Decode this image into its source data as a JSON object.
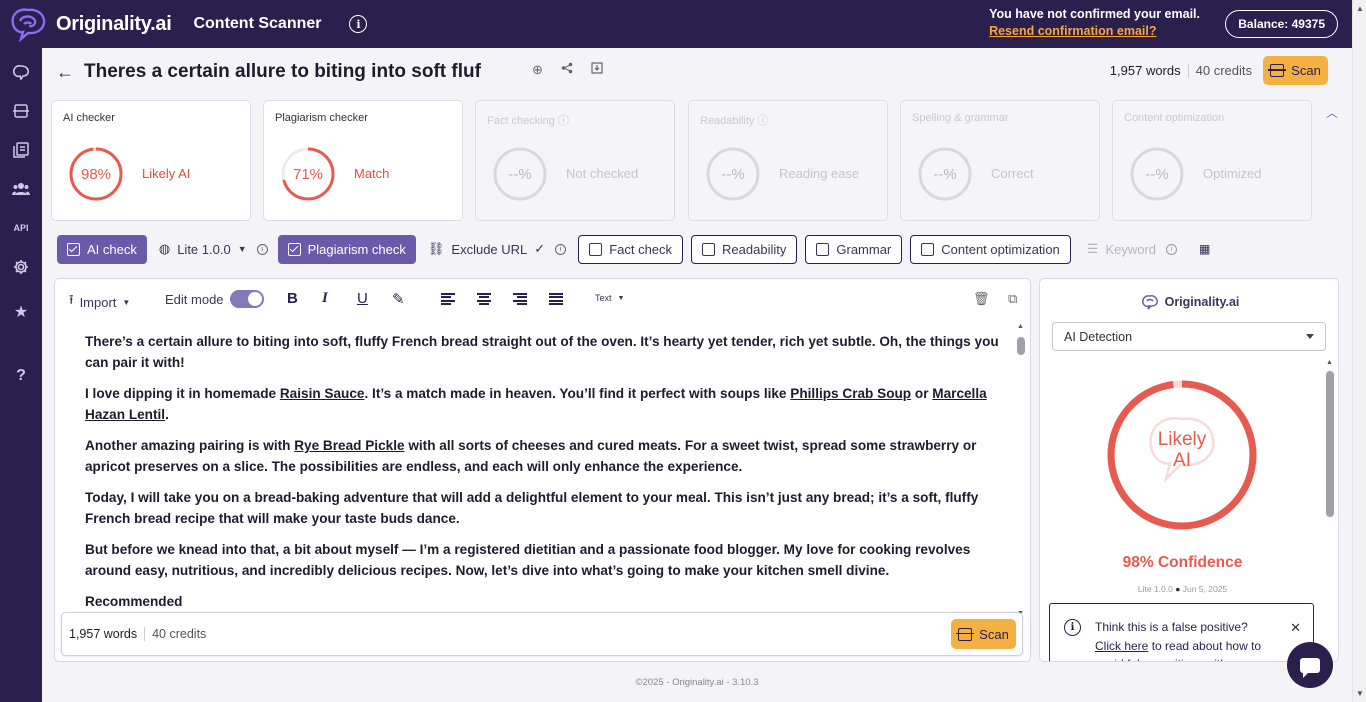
{
  "app": {
    "logo_text": "Originality.ai",
    "title": "Content Scanner",
    "email_notice": "You have not confirmed your email.",
    "resend_link": "Resend confirmation email?",
    "balance": "Balance: 49375"
  },
  "doc": {
    "title": "Theres a certain allure to biting into soft fluf",
    "words": "1,957 words",
    "credits": "40 credits",
    "scan_label": "Scan"
  },
  "cards": [
    {
      "title": "AI checker",
      "value": "98%",
      "status": "Likely AI",
      "active": true,
      "fill": 0.98
    },
    {
      "title": "Plagiarism checker",
      "value": "71%",
      "status": "Match",
      "active": true,
      "fill": 0.71
    },
    {
      "title": "Fact checking",
      "value": "--%",
      "status": "Not checked",
      "active": false
    },
    {
      "title": "Readability",
      "value": "--%",
      "status": "Reading ease",
      "active": false
    },
    {
      "title": "Spelling & grammar",
      "value": "--%",
      "status": "Correct",
      "active": false
    },
    {
      "title": "Content optimization",
      "value": "--%",
      "status": "Optimized",
      "active": false
    }
  ],
  "toolbar": {
    "ai_check": "AI check",
    "model": "Lite 1.0.0",
    "plagiarism_check": "Plagiarism check",
    "exclude_url": "Exclude URL",
    "fact_check": "Fact check",
    "readability": "Readability",
    "grammar": "Grammar",
    "content_optimization": "Content optimization",
    "keyword": "Keyword"
  },
  "editor": {
    "import": "Import",
    "edit_mode": "Edit mode",
    "text_style": "Text",
    "p1": "There’s a certain allure to biting into soft, fluffy French bread straight out of the oven. It’s hearty yet tender, rich yet subtle. Oh, the things you can pair it with!",
    "p2_a": "I love dipping it in homemade ",
    "p2_link1": "Raisin Sauce",
    "p2_b": ". It’s a match made in heaven. You’ll find it perfect with soups like ",
    "p2_link2": "Phillips Crab Soup",
    "p2_c": " or ",
    "p2_link3": "Marcella Hazan Lentil",
    "p2_d": ".",
    "p3_a": "Another amazing pairing is with ",
    "p3_link": "Rye Bread Pickle",
    "p3_b": " with all sorts of cheeses and cured meats. For a sweet twist, spread some strawberry or apricot preserves on a slice. The possibilities are endless, and each will only enhance the experience.",
    "p4": "Today, I will take you on a bread-baking adventure that will add a delightful element to your meal. This isn’t just any bread; it’s a soft, fluffy French bread recipe that will make your taste buds dance.",
    "p5": "But before we knead into that, a bit about myself — I’m a registered dietitian and a passionate food blogger. My love for cooking revolves around easy, nutritious, and incredibly delicious recipes. Now, let’s dive into what’s going to make your kitchen smell divine.",
    "p6": "Recommended",
    "footer_words": "1,957 words",
    "footer_credits": "40 credits",
    "scan_label": "Scan"
  },
  "panel": {
    "logo_text": "Originality.ai",
    "select_value": "AI Detection",
    "ring_line1": "Likely",
    "ring_line2": "AI",
    "confidence": "98% Confidence",
    "meta_model": "Lite 1.0.0",
    "meta_dot": "●",
    "meta_date": "Jun 5, 2025",
    "fp_title": "Think this is a false positive?",
    "fp_link": "Click here",
    "fp_rest": " to read about how to avoid false positives with our"
  },
  "footer": {
    "copyright": "©2025 - Originality.ai - 3.10.3"
  },
  "colors": {
    "brand_dark": "#2a1f4d",
    "accent_orange": "#f5b044",
    "ai_red": "#e65a4f",
    "purple": "#6a5aa8"
  }
}
